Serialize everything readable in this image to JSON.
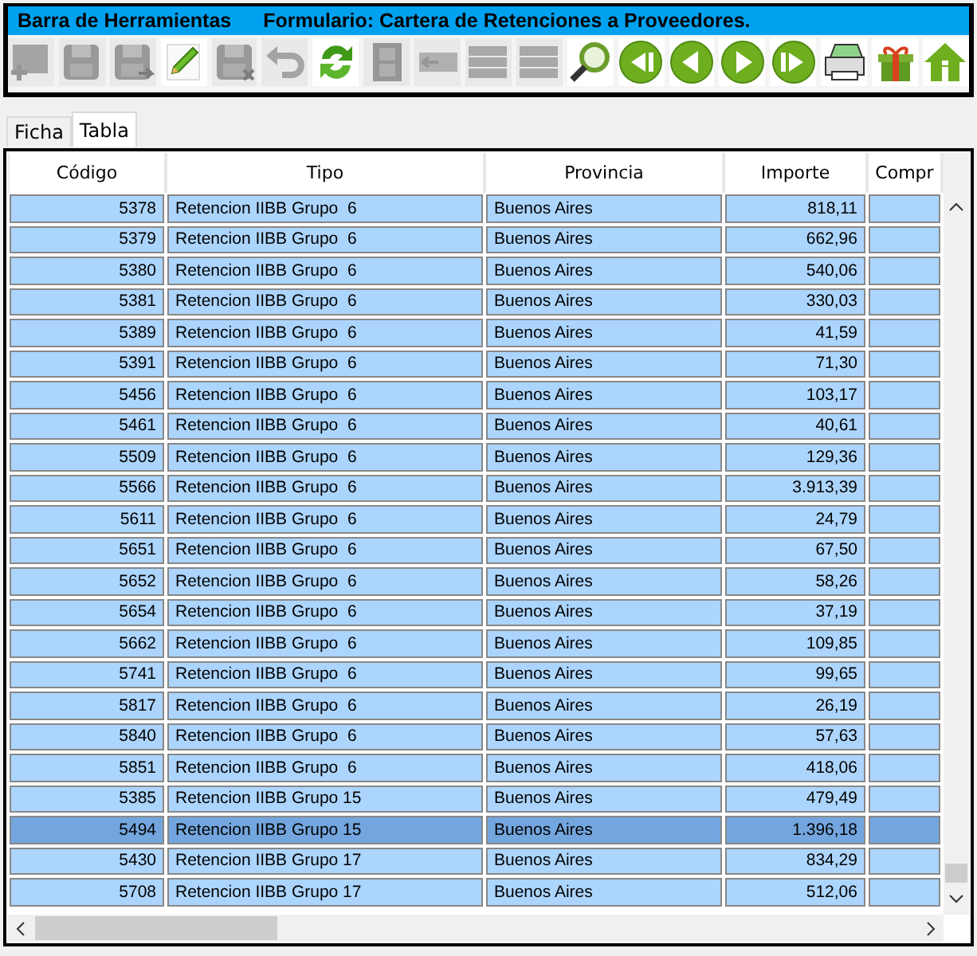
{
  "title_bar": {
    "left": "Barra de Herramientas",
    "right": "Formulario: Cartera de Retenciones a Proveedores."
  },
  "toolbar": [
    {
      "kind": "add",
      "disabled": true
    },
    {
      "kind": "save",
      "disabled": true
    },
    {
      "kind": "save-as",
      "disabled": true
    },
    {
      "kind": "edit",
      "disabled": false
    },
    {
      "kind": "discard",
      "disabled": true
    },
    {
      "kind": "undo",
      "disabled": true
    },
    {
      "kind": "refresh",
      "disabled": false
    },
    {
      "kind": "film",
      "disabled": true
    },
    {
      "kind": "back",
      "disabled": true
    },
    {
      "kind": "list",
      "disabled": true
    },
    {
      "kind": "list",
      "disabled": true
    },
    {
      "kind": "search",
      "disabled": false
    },
    {
      "kind": "first",
      "disabled": false
    },
    {
      "kind": "prev",
      "disabled": false
    },
    {
      "kind": "next",
      "disabled": false
    },
    {
      "kind": "last",
      "disabled": false
    },
    {
      "kind": "print",
      "disabled": false
    },
    {
      "kind": "gift",
      "disabled": false
    },
    {
      "kind": "home",
      "disabled": false
    }
  ],
  "tabs": [
    {
      "label": "Ficha",
      "selected": false
    },
    {
      "label": "Tabla",
      "selected": true
    }
  ],
  "table": {
    "columns": [
      "Código",
      "Tipo",
      "Provincia",
      "Importe",
      "Compr"
    ],
    "rows": [
      {
        "codigo": "5378",
        "tipo": "Retencion IIBB Grupo  6",
        "provincia": "Buenos Aires",
        "importe": "818,11",
        "selected": false
      },
      {
        "codigo": "5379",
        "tipo": "Retencion IIBB Grupo  6",
        "provincia": "Buenos Aires",
        "importe": "662,96",
        "selected": false
      },
      {
        "codigo": "5380",
        "tipo": "Retencion IIBB Grupo  6",
        "provincia": "Buenos Aires",
        "importe": "540,06",
        "selected": false
      },
      {
        "codigo": "5381",
        "tipo": "Retencion IIBB Grupo  6",
        "provincia": "Buenos Aires",
        "importe": "330,03",
        "selected": false
      },
      {
        "codigo": "5389",
        "tipo": "Retencion IIBB Grupo  6",
        "provincia": "Buenos Aires",
        "importe": "41,59",
        "selected": false
      },
      {
        "codigo": "5391",
        "tipo": "Retencion IIBB Grupo  6",
        "provincia": "Buenos Aires",
        "importe": "71,30",
        "selected": false
      },
      {
        "codigo": "5456",
        "tipo": "Retencion IIBB Grupo  6",
        "provincia": "Buenos Aires",
        "importe": "103,17",
        "selected": false
      },
      {
        "codigo": "5461",
        "tipo": "Retencion IIBB Grupo  6",
        "provincia": "Buenos Aires",
        "importe": "40,61",
        "selected": false
      },
      {
        "codigo": "5509",
        "tipo": "Retencion IIBB Grupo  6",
        "provincia": "Buenos Aires",
        "importe": "129,36",
        "selected": false
      },
      {
        "codigo": "5566",
        "tipo": "Retencion IIBB Grupo  6",
        "provincia": "Buenos Aires",
        "importe": "3.913,39",
        "selected": false
      },
      {
        "codigo": "5611",
        "tipo": "Retencion IIBB Grupo  6",
        "provincia": "Buenos Aires",
        "importe": "24,79",
        "selected": false
      },
      {
        "codigo": "5651",
        "tipo": "Retencion IIBB Grupo  6",
        "provincia": "Buenos Aires",
        "importe": "67,50",
        "selected": false
      },
      {
        "codigo": "5652",
        "tipo": "Retencion IIBB Grupo  6",
        "provincia": "Buenos Aires",
        "importe": "58,26",
        "selected": false
      },
      {
        "codigo": "5654",
        "tipo": "Retencion IIBB Grupo  6",
        "provincia": "Buenos Aires",
        "importe": "37,19",
        "selected": false
      },
      {
        "codigo": "5662",
        "tipo": "Retencion IIBB Grupo  6",
        "provincia": "Buenos Aires",
        "importe": "109,85",
        "selected": false
      },
      {
        "codigo": "5741",
        "tipo": "Retencion IIBB Grupo  6",
        "provincia": "Buenos Aires",
        "importe": "99,65",
        "selected": false
      },
      {
        "codigo": "5817",
        "tipo": "Retencion IIBB Grupo  6",
        "provincia": "Buenos Aires",
        "importe": "26,19",
        "selected": false
      },
      {
        "codigo": "5840",
        "tipo": "Retencion IIBB Grupo  6",
        "provincia": "Buenos Aires",
        "importe": "57,63",
        "selected": false
      },
      {
        "codigo": "5851",
        "tipo": "Retencion IIBB Grupo  6",
        "provincia": "Buenos Aires",
        "importe": "418,06",
        "selected": false
      },
      {
        "codigo": "5385",
        "tipo": "Retencion IIBB Grupo 15",
        "provincia": "Buenos Aires",
        "importe": "479,49",
        "selected": false
      },
      {
        "codigo": "5494",
        "tipo": "Retencion IIBB Grupo 15",
        "provincia": "Buenos Aires",
        "importe": "1.396,18",
        "selected": true
      },
      {
        "codigo": "5430",
        "tipo": "Retencion IIBB Grupo 17",
        "provincia": "Buenos Aires",
        "importe": "834,29",
        "selected": false
      },
      {
        "codigo": "5708",
        "tipo": "Retencion IIBB Grupo 17",
        "provincia": "Buenos Aires",
        "importe": "512,06",
        "selected": false
      }
    ]
  }
}
